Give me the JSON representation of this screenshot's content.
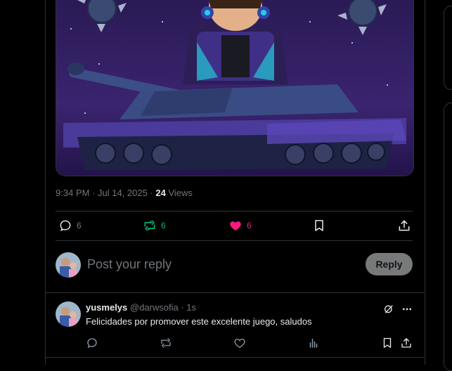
{
  "post": {
    "meta": {
      "time": "9:34 PM",
      "sep1": " · ",
      "date": "Jul 14, 2025",
      "sep2": " · ",
      "views_count": "24",
      "views_label": " Views"
    },
    "actions": {
      "replies": "6",
      "reposts": "6",
      "likes": "6"
    }
  },
  "reply_box": {
    "placeholder": "Post your reply",
    "button": "Reply"
  },
  "comment": {
    "name": "yusmelys",
    "handle": "@darwsofia",
    "time_sep": " · ",
    "time": "1s",
    "text": "Felicidades por promover este excelente juego, saludos"
  },
  "colors": {
    "repost_green": "#00ba7c",
    "like_pink": "#f91880",
    "muted": "#71767b"
  },
  "icons": [
    "reply-icon",
    "repost-icon",
    "like-icon",
    "bookmark-icon",
    "share-icon",
    "grok-icon",
    "more-icon",
    "views-icon"
  ]
}
